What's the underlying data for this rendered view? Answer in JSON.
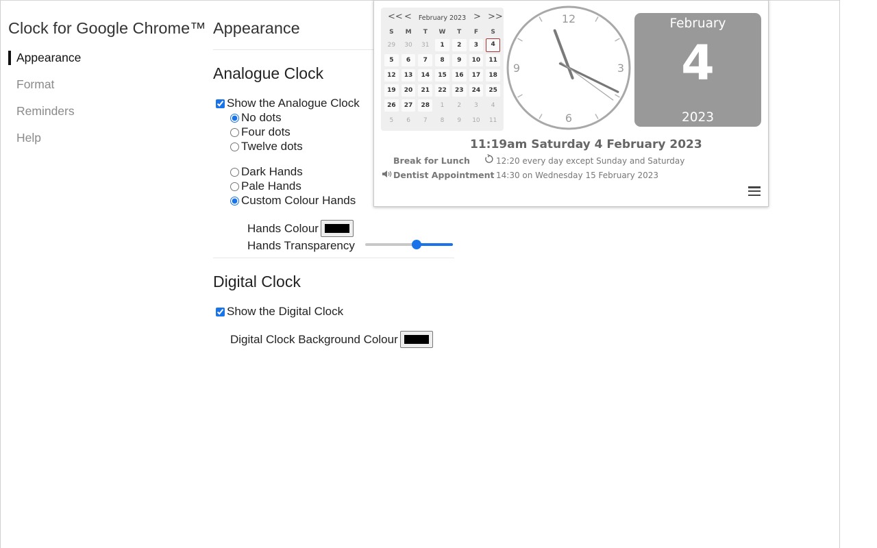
{
  "app": {
    "title": "Clock for Google Chrome™"
  },
  "nav": {
    "items": [
      {
        "label": "Appearance",
        "active": true
      },
      {
        "label": "Format",
        "active": false
      },
      {
        "label": "Reminders",
        "active": false
      },
      {
        "label": "Help",
        "active": false
      }
    ]
  },
  "page": {
    "title": "Appearance"
  },
  "analogue": {
    "heading": "Analogue Clock",
    "show_label": "Show the Analogue Clock",
    "show_checked": true,
    "dots": [
      {
        "label": "No dots",
        "checked": true
      },
      {
        "label": "Four dots",
        "checked": false
      },
      {
        "label": "Twelve dots",
        "checked": false
      }
    ],
    "hands": [
      {
        "label": "Dark Hands",
        "checked": false
      },
      {
        "label": "Pale Hands",
        "checked": false
      },
      {
        "label": "Custom Colour Hands",
        "checked": true
      }
    ],
    "hands_colour_label": "Hands Colour",
    "hands_colour": "#000000",
    "transparency_label": "Hands Transparency",
    "transparency_value": 0.6
  },
  "digital": {
    "heading": "Digital Clock",
    "show_label": "Show the Digital Clock",
    "show_checked": true,
    "bg_colour_label": "Digital Clock Background Colour",
    "bg_colour": "#000000"
  },
  "popup": {
    "calendar": {
      "nav_prev_year": "<<",
      "nav_prev": "<",
      "nav_next": ">",
      "nav_next_year": ">>",
      "month_label": "February 2023",
      "weekdays": [
        "S",
        "M",
        "T",
        "W",
        "T",
        "F",
        "S"
      ],
      "weeks": [
        [
          {
            "d": "29",
            "o": true
          },
          {
            "d": "30",
            "o": true
          },
          {
            "d": "31",
            "o": true
          },
          {
            "d": "1"
          },
          {
            "d": "2"
          },
          {
            "d": "3"
          },
          {
            "d": "4",
            "today": true
          }
        ],
        [
          {
            "d": "5"
          },
          {
            "d": "6"
          },
          {
            "d": "7"
          },
          {
            "d": "8"
          },
          {
            "d": "9"
          },
          {
            "d": "10"
          },
          {
            "d": "11"
          }
        ],
        [
          {
            "d": "12"
          },
          {
            "d": "13"
          },
          {
            "d": "14"
          },
          {
            "d": "15"
          },
          {
            "d": "16"
          },
          {
            "d": "17"
          },
          {
            "d": "18"
          }
        ],
        [
          {
            "d": "19"
          },
          {
            "d": "20"
          },
          {
            "d": "21"
          },
          {
            "d": "22"
          },
          {
            "d": "23"
          },
          {
            "d": "24"
          },
          {
            "d": "25"
          }
        ],
        [
          {
            "d": "26"
          },
          {
            "d": "27"
          },
          {
            "d": "28"
          },
          {
            "d": "1",
            "o": true
          },
          {
            "d": "2",
            "o": true
          },
          {
            "d": "3",
            "o": true
          },
          {
            "d": "4",
            "o": true
          }
        ],
        [
          {
            "d": "5",
            "o": true
          },
          {
            "d": "6",
            "o": true
          },
          {
            "d": "7",
            "o": true
          },
          {
            "d": "8",
            "o": true
          },
          {
            "d": "9",
            "o": true
          },
          {
            "d": "10",
            "o": true
          },
          {
            "d": "11",
            "o": true
          }
        ]
      ]
    },
    "clock": {
      "numerals": [
        "12",
        "3",
        "6",
        "9"
      ],
      "hour": 11,
      "minute": 19,
      "second": 21
    },
    "date_card": {
      "month": "February",
      "day": "4",
      "year": "2023",
      "bg": "#999999"
    },
    "time_text": "11:19am Saturday 4 February 2023",
    "reminders": [
      {
        "name": "Break for Lunch",
        "icon": "repeat-icon",
        "desc": "12:20 every day except Sunday and Saturday"
      },
      {
        "name": "Dentist Appointment",
        "icon": "speaker-icon",
        "desc": "14:30 on Wednesday 15 February 2023"
      }
    ],
    "menu_icon": "hamburger-icon"
  }
}
